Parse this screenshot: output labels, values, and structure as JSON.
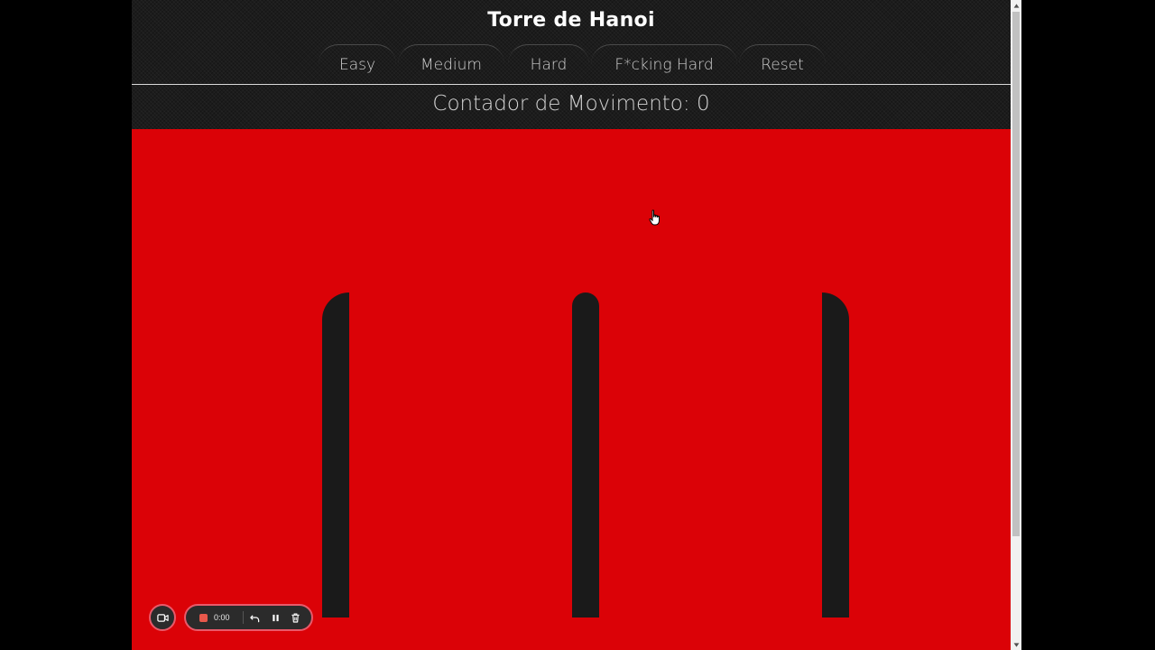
{
  "app": {
    "title": "Torre de Hanoi"
  },
  "nav": {
    "buttons": [
      {
        "label": "Easy"
      },
      {
        "label": "Medium"
      },
      {
        "label": "Hard"
      },
      {
        "label": "F*cking Hard"
      },
      {
        "label": "Reset"
      }
    ]
  },
  "counter": {
    "label": "Contador de Movimento: ",
    "value": "0"
  },
  "board": {
    "rods": 3,
    "disks": 0,
    "background_color": "#db0207",
    "rod_color": "#1a1a1a"
  },
  "recorder": {
    "time": "0:00",
    "icons": [
      "camera-icon",
      "stop-icon",
      "undo-icon",
      "pause-icon",
      "delete-icon"
    ],
    "accent_color": "#e85a6a"
  },
  "colors": {
    "header_bg": "#1c1c1c",
    "title_text": "#ffffff",
    "nav_text": "#cfcfcf"
  }
}
